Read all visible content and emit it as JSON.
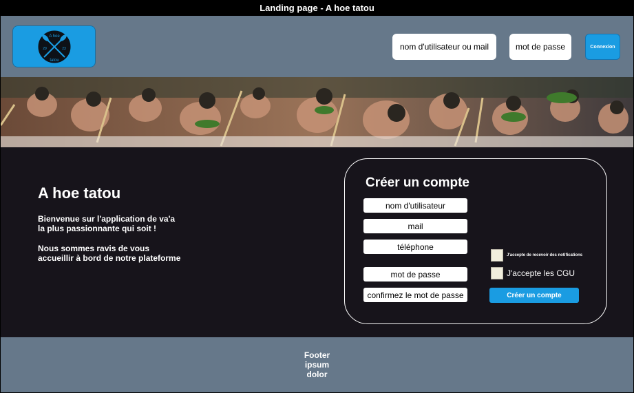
{
  "window": {
    "title": "Landing page - A hoe tatou"
  },
  "header": {
    "logo": {
      "text_top": "A hoe",
      "text_bottom": "tatou",
      "num_left": "29",
      "num_right": "23"
    },
    "username_placeholder": "nom d'utilisateur ou mail",
    "password_placeholder": "mot de passe",
    "connexion_label": "Connexion"
  },
  "intro": {
    "title": "A hoe tatou",
    "line1": "Bienvenue sur l'application de va'a la plus passionnante qui soit !",
    "line2": "Nous sommes ravis de vous accueillir à bord de notre plateforme"
  },
  "signup": {
    "title": "Créer un compte",
    "username": "nom d'utilisateur",
    "mail": "mail",
    "phone": "téléphone",
    "password": "mot de passe",
    "confirm_password": "confirmez le mot de passe",
    "notifications_label": "J'accepte de recevoir des notifications",
    "cgu_label": "J'accepte les CGU",
    "create_label": "Créer un compte"
  },
  "footer": {
    "line1": "Footer",
    "line2": "ipsum",
    "line3": "dolor"
  },
  "colors": {
    "accent": "#1a9ce2",
    "header_bg": "#66788a",
    "main_bg": "#17141b"
  }
}
